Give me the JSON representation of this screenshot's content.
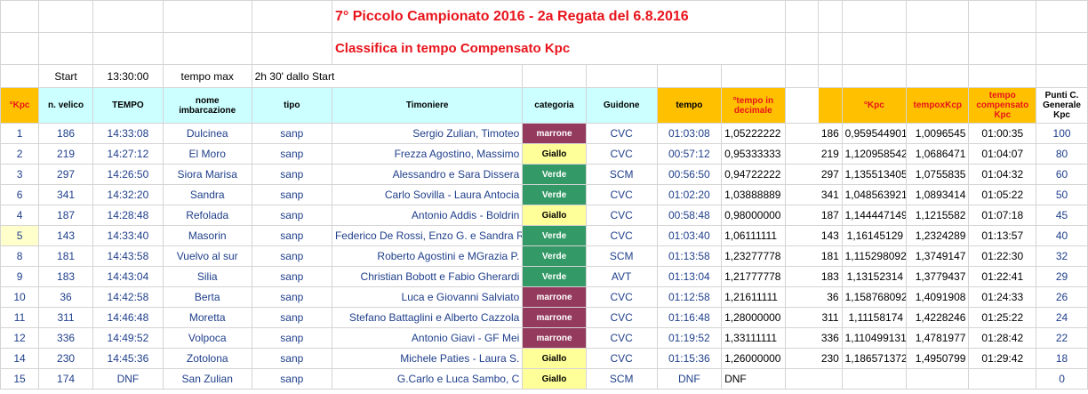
{
  "title": "7°  Piccolo Campionato 2016 - 2a Regata del 6.8.2016",
  "subtitle": "Classifica in tempo Compensato Kpc",
  "meta": {
    "start_label": "Start",
    "start_time": "13:30:00",
    "tempo_max_label": "tempo max",
    "tempo_max_value": "2h 30' dallo Start"
  },
  "headers": {
    "kpc": "°Kpc",
    "velico": "n. velico",
    "tempo": "TEMPO",
    "nome": "nome imbarcazione",
    "tipo": "tipo",
    "timoniere": "Timoniere",
    "categoria": "categoria",
    "guidone": "Guidone",
    "tempo2": "tempo",
    "tempo_dec": "°tempo in decimale",
    "kpc2": "°Kpc",
    "tempoxkcp": "tempoxKcp",
    "tempo_comp": "tempo compensato Kpc",
    "punti": "Punti C. Generale Kpc"
  },
  "colors": {
    "marrone": "#943a5c",
    "giallo": "#ffff99",
    "verde": "#339966",
    "header_cyan": "#ccffff",
    "header_orange": "#ffc000",
    "title_red": "#e8141c"
  },
  "rows": [
    {
      "kpc": "1",
      "velico": "186",
      "tempo": "14:33:08",
      "nome": "Dulcinea",
      "tipo": "sanp",
      "timoniere": "Sergio Zulian, Timoteo",
      "categoria": "marrone",
      "guidone": "CVC",
      "tempo2": "01:03:08",
      "dec": "1,05222222",
      "kpc2": "186",
      "kpcval": "0,959544901",
      "txk": "1,0096545",
      "comp": "01:00:35",
      "punti": "100"
    },
    {
      "kpc": "2",
      "velico": "219",
      "tempo": "14:27:12",
      "nome": "El Moro",
      "tipo": "sanp",
      "timoniere": "Frezza Agostino, Massimo",
      "categoria": "Giallo",
      "guidone": "CVC",
      "tempo2": "00:57:12",
      "dec": "0,95333333",
      "kpc2": "219",
      "kpcval": "1,120958542",
      "txk": "1,0686471",
      "comp": "01:04:07",
      "punti": "80"
    },
    {
      "kpc": "3",
      "velico": "297",
      "tempo": "14:26:50",
      "nome": "Siora Marisa",
      "tipo": "sanp",
      "timoniere": "Alessandro e Sara Dissera",
      "categoria": "Verde",
      "guidone": "SCM",
      "tempo2": "00:56:50",
      "dec": "0,94722222",
      "kpc2": "297",
      "kpcval": "1,135513405",
      "txk": "1,0755835",
      "comp": "01:04:32",
      "punti": "60"
    },
    {
      "kpc": "6",
      "velico": "341",
      "tempo": "14:32:20",
      "nome": "Sandra",
      "tipo": "sanp",
      "timoniere": "Carlo Sovilla - Laura Antocia",
      "categoria": "Verde",
      "guidone": "CVC",
      "tempo2": "01:02:20",
      "dec": "1,03888889",
      "kpc2": "341",
      "kpcval": "1,048563921",
      "txk": "1,0893414",
      "comp": "01:05:22",
      "punti": "50"
    },
    {
      "kpc": "4",
      "velico": "187",
      "tempo": "14:28:48",
      "nome": "Refolada",
      "tipo": "sanp",
      "timoniere": "Antonio Addis - Boldrin",
      "categoria": "Giallo",
      "guidone": "CVC",
      "tempo2": "00:58:48",
      "dec": "0,98000000",
      "kpc2": "187",
      "kpcval": "1,144447149",
      "txk": "1,1215582",
      "comp": "01:07:18",
      "punti": "45"
    },
    {
      "kpc": "5",
      "velico": "143",
      "tempo": "14:33:40",
      "nome": "Masorin",
      "tipo": "sanp",
      "timoniere": "Federico De Rossi, Enzo G. e Sandra R.",
      "categoria": "Verde",
      "guidone": "CVC",
      "tempo2": "01:03:40",
      "dec": "1,06111111",
      "kpc2": "143",
      "kpcval": "1,16145129",
      "txk": "1,2324289",
      "comp": "01:13:57",
      "punti": "40"
    },
    {
      "kpc": "8",
      "velico": "181",
      "tempo": "14:43:58",
      "nome": "Vuelvo al sur",
      "tipo": "sanp",
      "timoniere": "Roberto Agostini e MGrazia P.",
      "categoria": "Verde",
      "guidone": "SCM",
      "tempo2": "01:13:58",
      "dec": "1,23277778",
      "kpc2": "181",
      "kpcval": "1,115298092",
      "txk": "1,3749147",
      "comp": "01:22:30",
      "punti": "32"
    },
    {
      "kpc": "9",
      "velico": "183",
      "tempo": "14:43:04",
      "nome": "Silia",
      "tipo": "sanp",
      "timoniere": "Christian Bobott  e Fabio Gherardi",
      "categoria": "Verde",
      "guidone": "AVT",
      "tempo2": "01:13:04",
      "dec": "1,21777778",
      "kpc2": "183",
      "kpcval": "1,13152314",
      "txk": "1,3779437",
      "comp": "01:22:41",
      "punti": "29"
    },
    {
      "kpc": "10",
      "velico": "36",
      "tempo": "14:42:58",
      "nome": "Berta",
      "tipo": "sanp",
      "timoniere": "Luca e Giovanni Salviato",
      "categoria": "marrone",
      "guidone": "CVC",
      "tempo2": "01:12:58",
      "dec": "1,21611111",
      "kpc2": "36",
      "kpcval": "1,158768092",
      "txk": "1,4091908",
      "comp": "01:24:33",
      "punti": "26"
    },
    {
      "kpc": "11",
      "velico": "311",
      "tempo": "14:46:48",
      "nome": "Moretta",
      "tipo": "sanp",
      "timoniere": "Stefano Battaglini e Alberto Cazzola",
      "categoria": "marrone",
      "guidone": "CVC",
      "tempo2": "01:16:48",
      "dec": "1,28000000",
      "kpc2": "311",
      "kpcval": "1,11158174",
      "txk": "1,4228246",
      "comp": "01:25:22",
      "punti": "24"
    },
    {
      "kpc": "12",
      "velico": "336",
      "tempo": "14:49:52",
      "nome": "Volpoca",
      "tipo": "sanp",
      "timoniere": "Antonio Giavi  - GF Mei",
      "categoria": "marrone",
      "guidone": "CVC",
      "tempo2": "01:19:52",
      "dec": "1,33111111",
      "kpc2": "336",
      "kpcval": "1,110499131",
      "txk": "1,4781977",
      "comp": "01:28:42",
      "punti": "22"
    },
    {
      "kpc": "14",
      "velico": "230",
      "tempo": "14:45:36",
      "nome": "Zotolona",
      "tipo": "sanp",
      "timoniere": "Michele Paties - Laura S.",
      "categoria": "Giallo",
      "guidone": "CVC",
      "tempo2": "01:15:36",
      "dec": "1,26000000",
      "kpc2": "230",
      "kpcval": "1,186571372",
      "txk": "1,4950799",
      "comp": "01:29:42",
      "punti": "18"
    },
    {
      "kpc": "15",
      "velico": "174",
      "tempo": "DNF",
      "nome": "San Zulian",
      "tipo": "sanp",
      "timoniere": "G.Carlo e Luca Sambo, C",
      "categoria": "Giallo",
      "guidone": "SCM",
      "tempo2": "DNF",
      "dec": "DNF",
      "kpc2": "",
      "kpcval": "",
      "txk": "",
      "comp": "",
      "punti": "0"
    }
  ]
}
